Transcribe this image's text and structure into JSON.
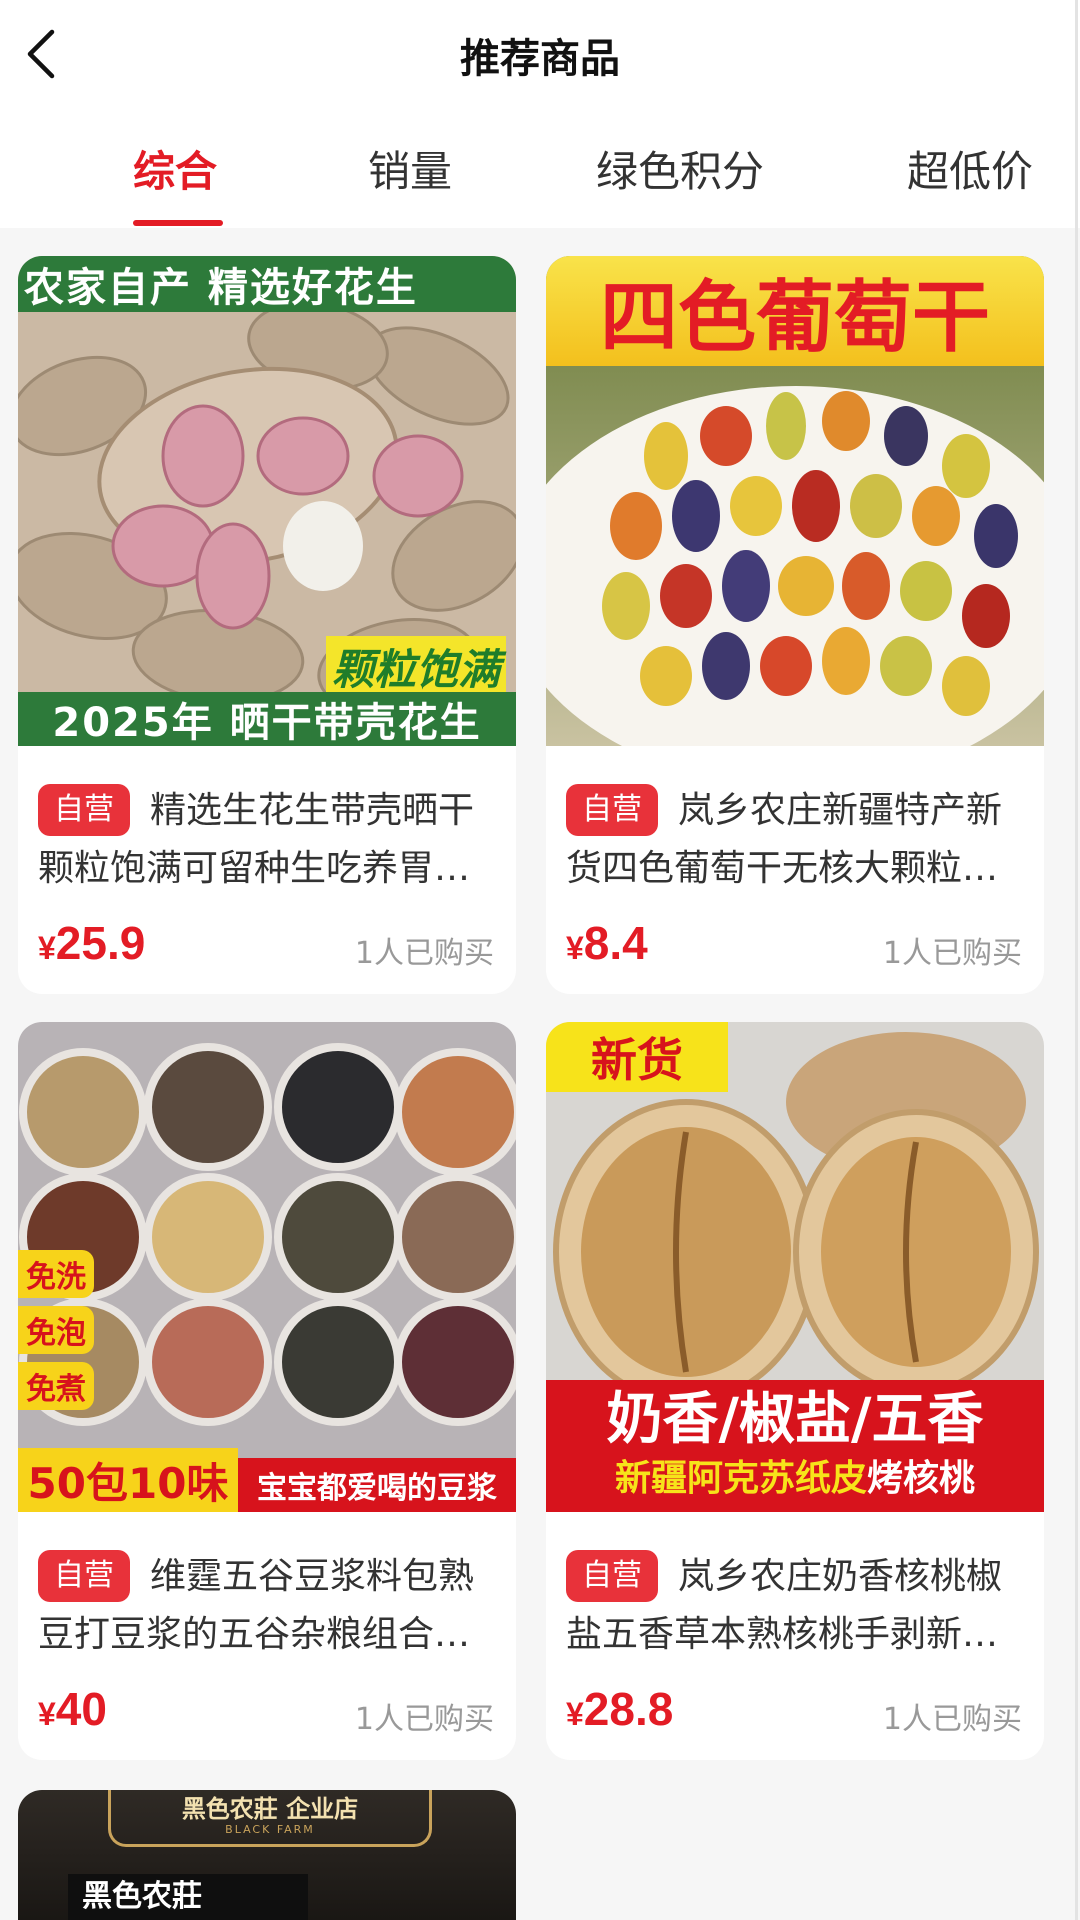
{
  "header": {
    "title": "推荐商品",
    "back_icon": "chevron-left-icon"
  },
  "tabs": [
    {
      "label": "综合",
      "active": true
    },
    {
      "label": "销量",
      "active": false
    },
    {
      "label": "绿色积分",
      "active": false
    },
    {
      "label": "超低价",
      "active": false
    }
  ],
  "products": [
    {
      "image_top": "农家自产  精选好花生",
      "image_tag": "颗粒饱满",
      "image_bottom": "2025年 晒干带壳花生",
      "badge": "自营",
      "title": "精选生花生带壳晒干颗粒饱满可留种生吃养胃…",
      "currency": "¥",
      "price": "25.9",
      "sold": "1人已购买"
    },
    {
      "image_top": "四色葡萄干",
      "badge": "自营",
      "title": "岚乡农庄新疆特产新货四色葡萄干无核大颗粒…",
      "currency": "¥",
      "price": "8.4",
      "sold": "1人已购买"
    },
    {
      "image_tags": [
        "免洗",
        "免泡",
        "免煮"
      ],
      "image_left": "50包10味",
      "image_right": "宝宝都爱喝的豆浆",
      "badge": "自营",
      "title": "维霆五谷豆浆料包熟豆打豆浆的五谷杂粮组合…",
      "currency": "¥",
      "price": "40",
      "sold": "1人已购买"
    },
    {
      "image_corner": "新货",
      "image_line1": "奶香/椒盐/五香",
      "image_line2a": "新疆阿克苏纸皮",
      "image_line2b": "烤核桃",
      "badge": "自营",
      "title": "岚乡农庄奶香核桃椒盐五香草本熟核桃手剥新…",
      "currency": "¥",
      "price": "28.8",
      "sold": "1人已购买"
    },
    {
      "image_logo": "黑色农莊 企业店",
      "image_logo_en": "BLACK FARM",
      "image_box": "黑色农莊"
    }
  ],
  "colors": {
    "accent": "#e31c25",
    "badge": "#e8323a",
    "peanut_band": "#2d7a3a",
    "walnut_band": "#d7131c",
    "tag_yellow": "#f7d31a"
  }
}
